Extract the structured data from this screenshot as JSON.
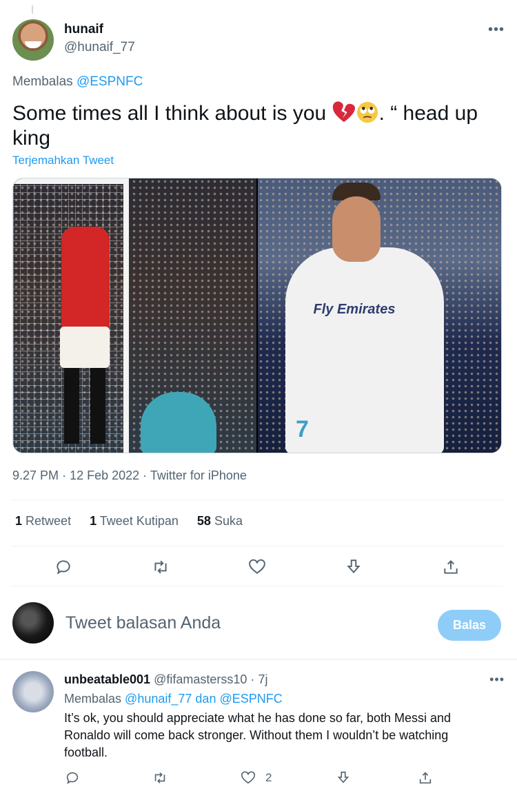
{
  "main_tweet": {
    "display_name": "hunaif",
    "handle": "@hunaif_77",
    "reply_to_prefix": "Membalas",
    "reply_to_mention": "@ESPNFC",
    "text_before_emoji": "Some times all I think about is you ",
    "text_after_emoji": ". “ head up king",
    "emojis": [
      "broken-heart",
      "rolling-eyes-face"
    ],
    "translate_label": "Terjemahkan Tweet",
    "media_shirt_text": "Fly Emirates",
    "media_shirt_number": "7",
    "time": "9.27 PM",
    "date": "12 Feb 2022",
    "source": "Twitter for iPhone",
    "stats": [
      {
        "count": "1",
        "label": "Retweet"
      },
      {
        "count": "1",
        "label": "Tweet Kutipan"
      },
      {
        "count": "58",
        "label": "Suka"
      }
    ],
    "actions": [
      "reply-icon",
      "retweet-icon",
      "like-icon",
      "bookmark-icon",
      "share-icon"
    ]
  },
  "reply_composer": {
    "placeholder": "Tweet balasan Anda",
    "button_label": "Balas",
    "button_color": "#8ecdf7"
  },
  "reply_tweet": {
    "display_name": "unbeatable001",
    "handle": "@fifamasterss10",
    "separator": "·",
    "time_ago": "7j",
    "reply_to_prefix": "Membalas",
    "reply_to_mention_1": "@hunaif_77",
    "reply_to_joiner": "dan",
    "reply_to_mention_2": "@ESPNFC",
    "text": "It’s ok, you should appreciate what he has done so far, both Messi and Ronaldo will come back stronger. Without them I wouldn’t be watching football.",
    "like_count": "2"
  },
  "more_glyph": "•••",
  "colors": {
    "accent": "#1d9bf0",
    "text_secondary": "#536471",
    "divider": "#eff3f4"
  }
}
